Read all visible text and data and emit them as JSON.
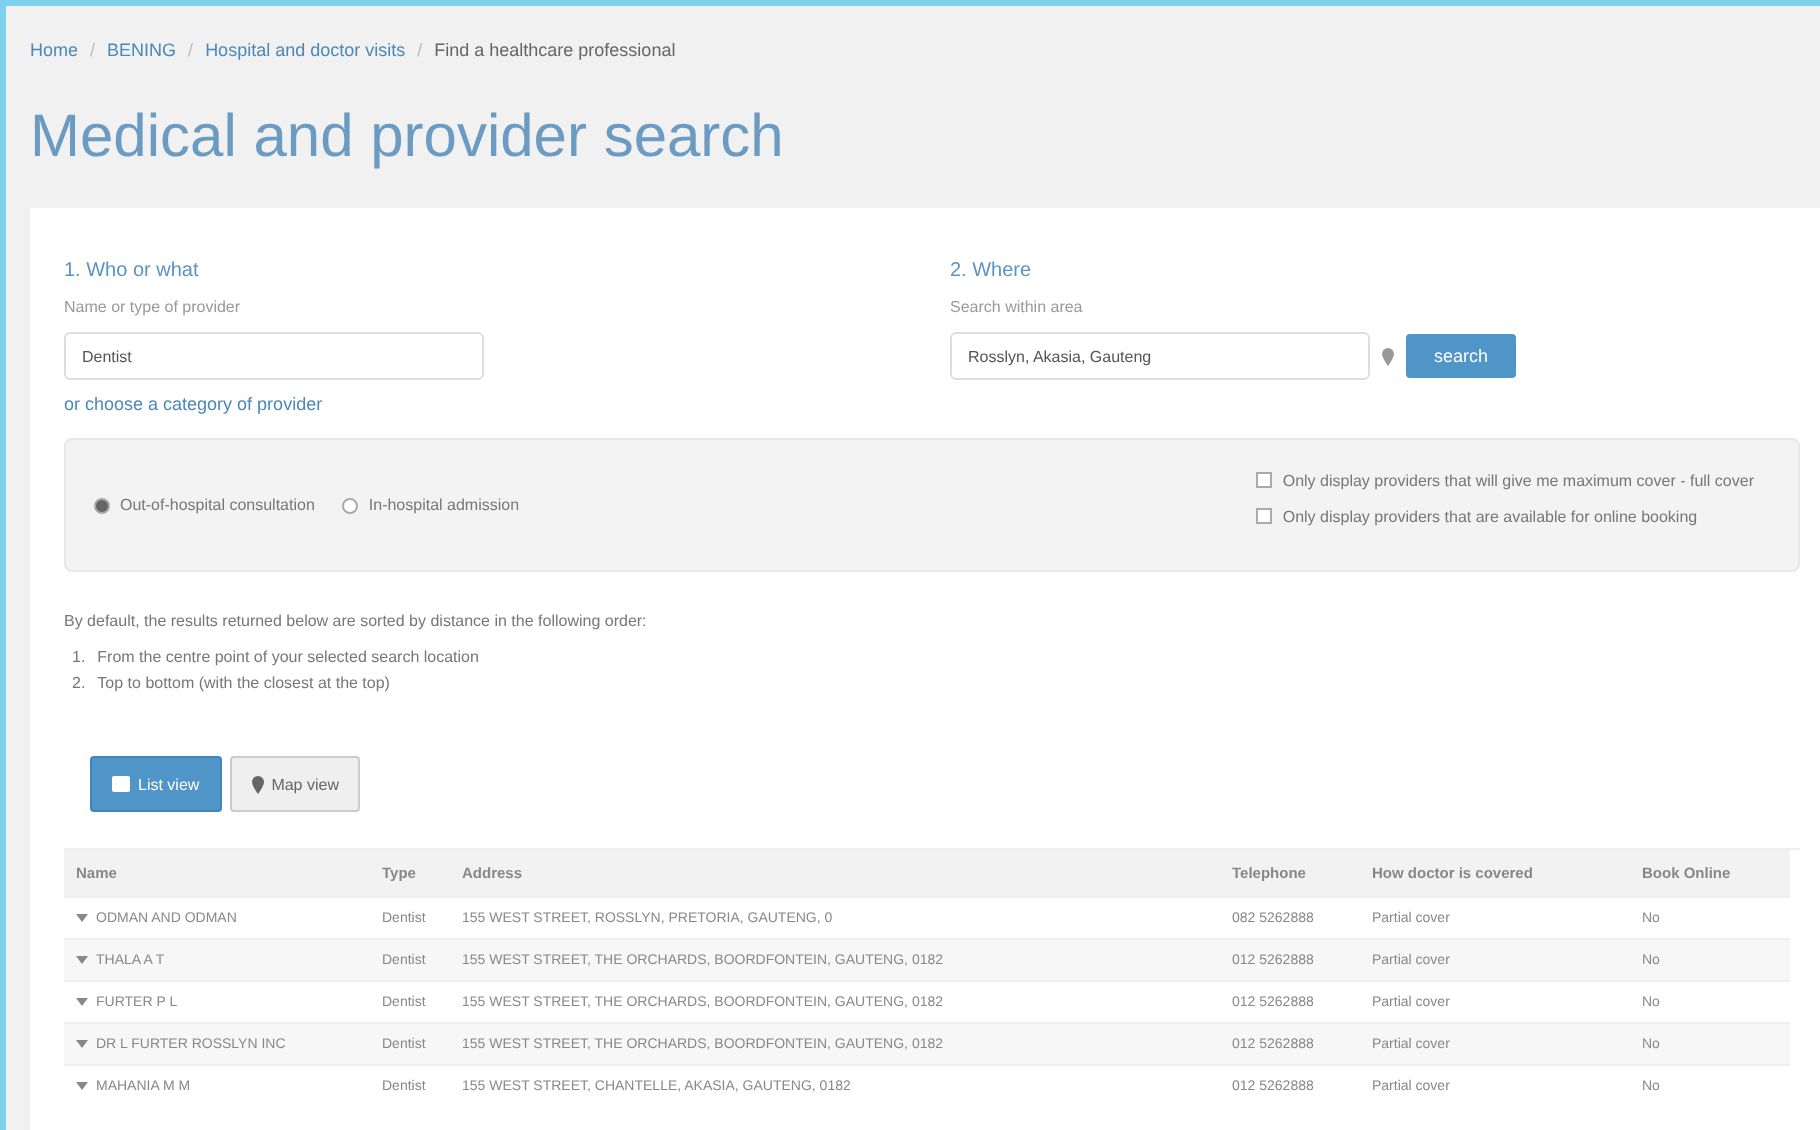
{
  "breadcrumb": [
    {
      "kind": "link",
      "label": "Home"
    },
    {
      "kind": "separator",
      "label": "/"
    },
    {
      "kind": "link",
      "label": "BENING"
    },
    {
      "kind": "separator",
      "label": "/"
    },
    {
      "kind": "link",
      "label": "Hospital and doctor visits"
    },
    {
      "kind": "separator",
      "label": "/"
    },
    {
      "kind": "current",
      "label": "Find a healthcare professional"
    }
  ],
  "title": "Medical and provider search",
  "who": {
    "heading": "1. Who or what",
    "label": "Name or type of provider",
    "value": "Dentist",
    "link": "or choose a category of provider"
  },
  "where": {
    "heading": "2. Where",
    "label": "Search within area",
    "value": "Rosslyn, Akasia, Gauteng",
    "button": "search"
  },
  "visit_types": [
    {
      "label": "Out-of-hospital consultation",
      "selected": true
    },
    {
      "label": "In-hospital admission",
      "selected": false
    }
  ],
  "filters": [
    {
      "label": "Only display providers that will give me maximum cover - full cover",
      "checked": false
    },
    {
      "label": "Only display providers that are available for online booking",
      "checked": false
    }
  ],
  "sort_note": "By default, the results returned below are sorted by distance in the following order:",
  "sort_steps": [
    {
      "number": "1.",
      "text": "From the centre point of your selected search location"
    },
    {
      "number": "2.",
      "text": "Top to bottom (with the closest at the top)"
    }
  ],
  "views": [
    {
      "label": "List view",
      "kind": "list",
      "selected": true
    },
    {
      "label": "Map view",
      "kind": "map",
      "selected": false
    }
  ],
  "table": {
    "columns": [
      "Name",
      "Type",
      "Address",
      "Telephone",
      "How doctor is covered",
      "Book Online"
    ],
    "rows": [
      [
        "ODMAN AND ODMAN",
        "Dentist",
        "155 WEST STREET, ROSSLYN, PRETORIA, GAUTENG, 0",
        "082 5262888",
        "Partial cover",
        "No"
      ],
      [
        "THALA A T",
        "Dentist",
        "155 WEST STREET, THE ORCHARDS, BOORDFONTEIN, GAUTENG, 0182",
        "012 5262888",
        "Partial cover",
        "No"
      ],
      [
        "FURTER P L",
        "Dentist",
        "155 WEST STREET, THE ORCHARDS, BOORDFONTEIN, GAUTENG, 0182",
        "012 5262888",
        "Partial cover",
        "No"
      ],
      [
        "DR L FURTER ROSSLYN INC",
        "Dentist",
        "155 WEST STREET, THE ORCHARDS, BOORDFONTEIN, GAUTENG, 0182",
        "012 5262888",
        "Partial cover",
        "No"
      ],
      [
        "MAHANIA M M",
        "Dentist",
        "155 WEST STREET, CHANTELLE, AKASIA, GAUTENG, 0182",
        "012 5262888",
        "Partial cover",
        "No"
      ]
    ]
  }
}
